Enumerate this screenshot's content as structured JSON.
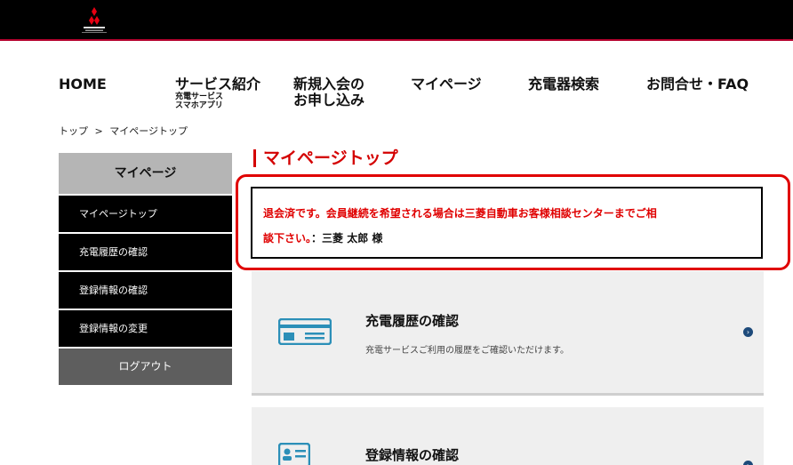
{
  "header": {
    "logo_icon": "mitsubishi-motors-logo",
    "bar_color": "#000000",
    "accent_color": "#b3002d"
  },
  "nav": {
    "home": "HOME",
    "service": "サービス紹介",
    "service_sub1": "充電サービス",
    "service_sub2": "スマホアプリ",
    "join1": "新規入会の",
    "join2": "お申し込み",
    "mypage": "マイページ",
    "charger": "充電器検索",
    "contact": "お問合せ・FAQ"
  },
  "breadcrumb": {
    "top": "トップ",
    "sep": ">",
    "current": "マイページトップ"
  },
  "sidebar": {
    "heading": "マイページ",
    "items": [
      "マイページトップ",
      "充電履歴の確認",
      "登録情報の確認",
      "登録情報の変更"
    ],
    "logout": "ログアウト"
  },
  "main": {
    "title": "マイページトップ",
    "alert_line1": "退会済です。会員継続を希望される場合は三菱自動車お客様相談センターまでご相",
    "alert_line2": "談下さい。",
    "alert_user": "：三菱 太郎 様",
    "alert_color": "#e00000"
  },
  "cards": [
    {
      "title": "充電履歴の確認",
      "desc": "充電サービスご利用の履歴をご確認いただけます。",
      "icon": "card-icon",
      "arrow_icon": "chevron-right-icon"
    },
    {
      "title": "登録情報の確認",
      "icon": "id-card-icon",
      "arrow_icon": "chevron-right-icon"
    }
  ]
}
